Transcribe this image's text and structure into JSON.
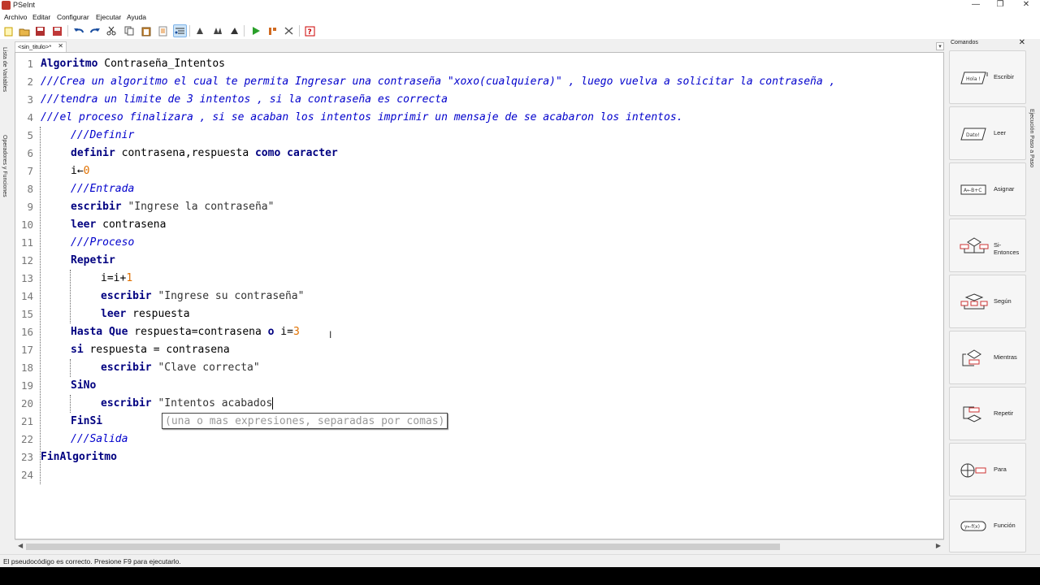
{
  "window": {
    "title": "PSeInt"
  },
  "menu": [
    "Archivo",
    "Editar",
    "Configurar",
    "Ejecutar",
    "Ayuda"
  ],
  "toolbar": {
    "buttons": [
      "new-file-icon",
      "open-file-icon",
      "save-icon",
      "save-as-icon",
      "undo-icon",
      "redo-icon",
      "cut-icon",
      "copy-icon",
      "paste-icon",
      "find-icon",
      "indent-icon",
      "run-step-icon",
      "run-icon",
      "debug-icon",
      "flowchart-icon",
      "help-icon"
    ]
  },
  "side_tabs": {
    "left1": "Lista de Variables",
    "left2": "Operadores y Funciones",
    "right": "Ejecución Paso a Paso"
  },
  "tab": {
    "label": "<sin_titulo>*",
    "close": "✕"
  },
  "editor": {
    "lines": [
      {
        "n": "1"
      },
      {
        "n": "2"
      },
      {
        "n": "3"
      },
      {
        "n": "4"
      },
      {
        "n": "5"
      },
      {
        "n": "6"
      },
      {
        "n": "7"
      },
      {
        "n": "8"
      },
      {
        "n": "9"
      },
      {
        "n": "10"
      },
      {
        "n": "11"
      },
      {
        "n": "12"
      },
      {
        "n": "13"
      },
      {
        "n": "14"
      },
      {
        "n": "15"
      },
      {
        "n": "16"
      },
      {
        "n": "17"
      },
      {
        "n": "18"
      },
      {
        "n": "19"
      },
      {
        "n": "20"
      },
      {
        "n": "21"
      },
      {
        "n": "22"
      },
      {
        "n": "23"
      },
      {
        "n": "24"
      }
    ],
    "code": {
      "l1_kw": "Algoritmo",
      "l1_rest": " Contraseña_Intentos",
      "l2": "///Crea un algoritmo el cual te permita Ingresar una contraseña \"xoxo(cualquiera)\" , luego vuelva a solicitar la contraseña ,",
      "l3": "///tendra un limite de 3 intentos , si la contraseña es correcta",
      "l4": "///el proceso finalizara , si se acaban los intentos imprimir un mensaje de se acabaron los intentos.",
      "l5": "///Definir",
      "l6_kw1": "definir",
      "l6_mid": " contrasena,respuesta ",
      "l6_kw2": "como caracter",
      "l7_a": "i←",
      "l7_num": "0",
      "l8": "///Entrada",
      "l9_kw": "escribir",
      "l9_str": " \"Ingrese la contraseña\"",
      "l10_kw": "leer",
      "l10_rest": " contrasena",
      "l11": "///Proceso",
      "l12_kw": "Repetir",
      "l13_a": "i=i+",
      "l13_num": "1",
      "l14_kw": "escribir",
      "l14_str": " \"Ingrese su contraseña\"",
      "l15_kw": "leer",
      "l15_rest": " respuesta",
      "l16_kw": "Hasta Que",
      "l16_mid": " respuesta=contrasena ",
      "l16_kw2": "o",
      "l16_b": " i=",
      "l16_num": "3",
      "l17_kw": "si",
      "l17_rest": " respuesta = contrasena",
      "l18_kw": "escribir",
      "l18_str": " \"Clave correcta\"",
      "l19_kw": "SiNo",
      "l20_kw": "escribir",
      "l20_str": " \"Intentos acabados",
      "l21_kw": "FinSi",
      "l22": "///Salida",
      "l23_kw": "FinAlgoritmo"
    },
    "tooltip": "(una o mas expresiones, separadas por comas)"
  },
  "commands": {
    "title": "Comandos",
    "items": [
      {
        "label": "Escribir",
        "icon": "escribir-icon",
        "glyph": "Hola !"
      },
      {
        "label": "Leer",
        "icon": "leer-icon",
        "glyph": "Dato!"
      },
      {
        "label": "Asignar",
        "icon": "asignar-icon",
        "glyph": "A←B+C"
      },
      {
        "label": "Si-Entonces",
        "icon": "si-entonces-icon",
        "glyph": ""
      },
      {
        "label": "Según",
        "icon": "segun-icon",
        "glyph": ""
      },
      {
        "label": "Mientras",
        "icon": "mientras-icon",
        "glyph": ""
      },
      {
        "label": "Repetir",
        "icon": "repetir-icon",
        "glyph": ""
      },
      {
        "label": "Para",
        "icon": "para-icon",
        "glyph": ""
      },
      {
        "label": "Función",
        "icon": "funcion-icon",
        "glyph": "y←f(x)"
      }
    ]
  },
  "status": "El pseudocódigo es correcto. Presione F9 para ejecutarlo."
}
